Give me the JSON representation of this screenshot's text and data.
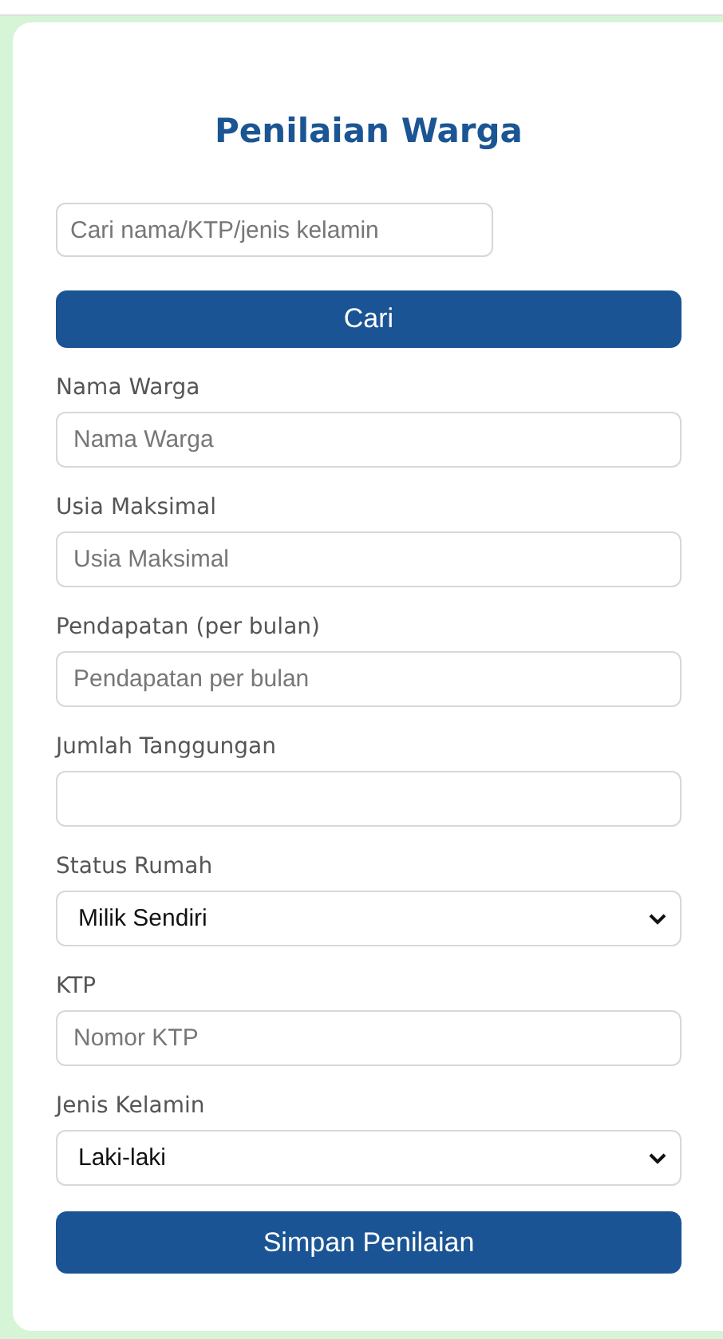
{
  "title": "Penilaian Warga",
  "search": {
    "placeholder": "Cari nama/KTP/jenis kelamin"
  },
  "search_button": "Cari",
  "fields": [
    {
      "kind": "text",
      "label": "Nama Warga",
      "placeholder": "Nama Warga"
    },
    {
      "kind": "text",
      "label": "Usia Maksimal",
      "placeholder": "Usia Maksimal"
    },
    {
      "kind": "text",
      "label": "Pendapatan (per bulan)",
      "placeholder": "Pendapatan per bulan"
    },
    {
      "kind": "text",
      "label": "Jumlah Tanggungan"
    },
    {
      "kind": "select",
      "label": "Status Rumah",
      "value": "Milik Sendiri"
    },
    {
      "kind": "text",
      "label": "KTP",
      "placeholder": "Nomor KTP"
    },
    {
      "kind": "select",
      "label": "Jenis Kelamin",
      "value": "Laki-laki"
    }
  ],
  "submit_button": "Simpan Penilaian"
}
